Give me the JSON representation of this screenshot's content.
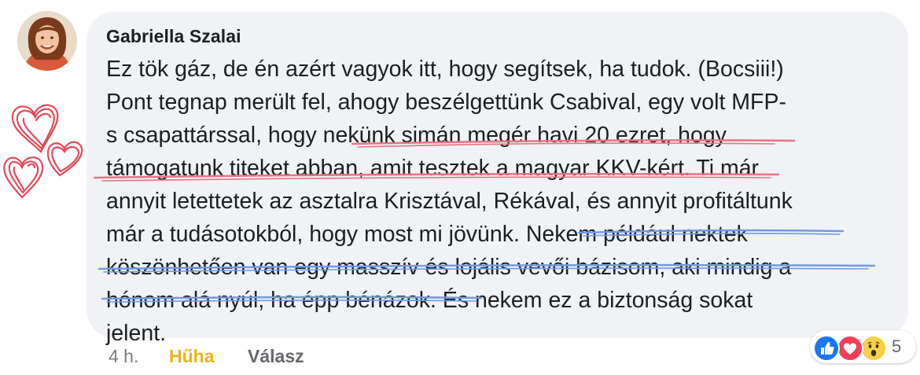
{
  "post": {
    "author": "Gabriella Szalai",
    "lines": [
      "Ez tök gáz, de én azért vagyok itt, hogy segítsek, ha tudok. (Bocsiii!)",
      "Pont tegnap merült fel, ahogy beszélgettünk Csabival, egy volt MFP-",
      "s csapattárssal, hogy nekünk simán megér havi 20 ezret, hogy",
      "támogatunk titeket abban, amit tesztek a magyar KKV-kért. Ti már",
      "annyit letettetek az asztalra Krisztával, Rékával, és annyit profitáltunk",
      "már a tudásotokból, hogy most mi jövünk. Nekem például nektek",
      "köszönhetően van egy masszív és lojális vevői bázisom, aki mindig a",
      "hónom alá nyúl, ha épp bénázok. És nekem ez a biztonság sokat",
      "jelent."
    ]
  },
  "footer": {
    "time": "4 h.",
    "reaction_label": "Hűha",
    "reply_label": "Válasz"
  },
  "reactions": {
    "icons": [
      "like-icon",
      "love-icon",
      "wow-icon"
    ],
    "count": "5"
  },
  "annotations": {
    "red_underline_color": "#e8737f",
    "blue_underline_color": "#6f9be3",
    "hearts_color": "#e24b59"
  },
  "colors": {
    "bubble_bg": "#f0f2f5",
    "text": "#1c1e21",
    "meta_text": "#65676b",
    "reaction_label": "#e7b619"
  }
}
